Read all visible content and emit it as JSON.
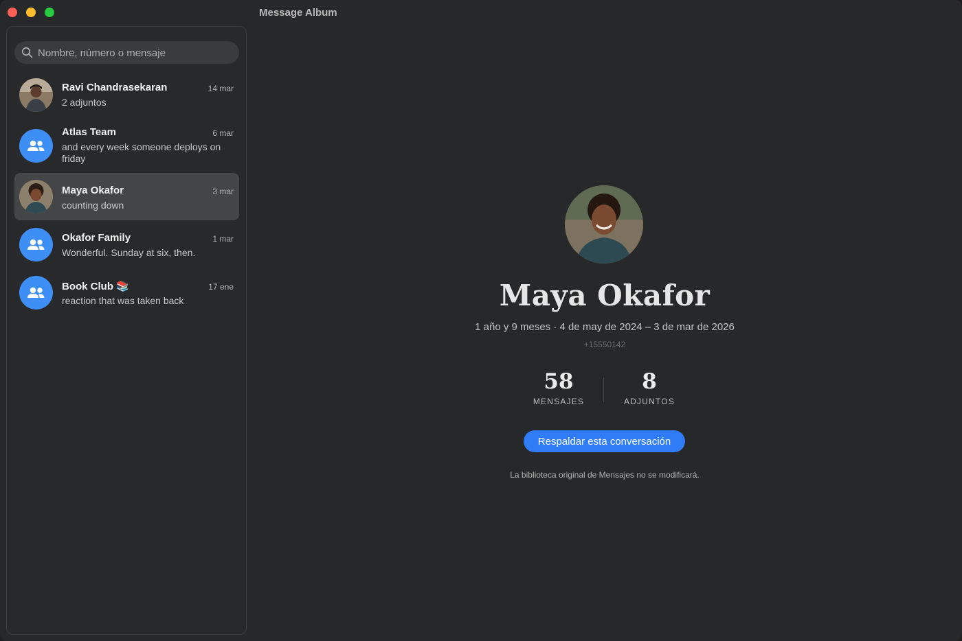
{
  "window": {
    "title": "Message Album"
  },
  "search": {
    "placeholder": "Nombre, número o mensaje"
  },
  "conversations": [
    {
      "name": "Ravi Chandrasekaran",
      "date": "14 mar",
      "preview": "2 adjuntos",
      "avatar": "person-photo-icon",
      "selected": false
    },
    {
      "name": "Atlas Team",
      "date": "6 mar",
      "preview": "and every week someone deploys on friday",
      "avatar": "group-icon",
      "selected": false
    },
    {
      "name": "Maya Okafor",
      "date": "3 mar",
      "preview": "counting down",
      "avatar": "person-photo-icon",
      "selected": true
    },
    {
      "name": "Okafor Family",
      "date": "1 mar",
      "preview": "Wonderful. Sunday at six, then.",
      "avatar": "group-icon",
      "selected": false
    },
    {
      "name": "Book Club 📚",
      "date": "17 ene",
      "preview": "reaction that was taken back",
      "avatar": "group-icon",
      "selected": false
    }
  ],
  "detail": {
    "name": "Maya Okafor",
    "range": "1 año y 9 meses · 4 de may de 2024 – 3 de mar de 2026",
    "phone": "+15550142",
    "stats": [
      {
        "value": "58",
        "label": "MENSAJES"
      },
      {
        "value": "8",
        "label": "ADJUNTOS"
      }
    ],
    "backup_label": "Respaldar esta conversación",
    "note": "La biblioteca original de Mensajes no se modificará."
  },
  "colors": {
    "accent": "#2f7cf6",
    "group_avatar": "#3d8ef5",
    "selected_row": "#444547"
  }
}
